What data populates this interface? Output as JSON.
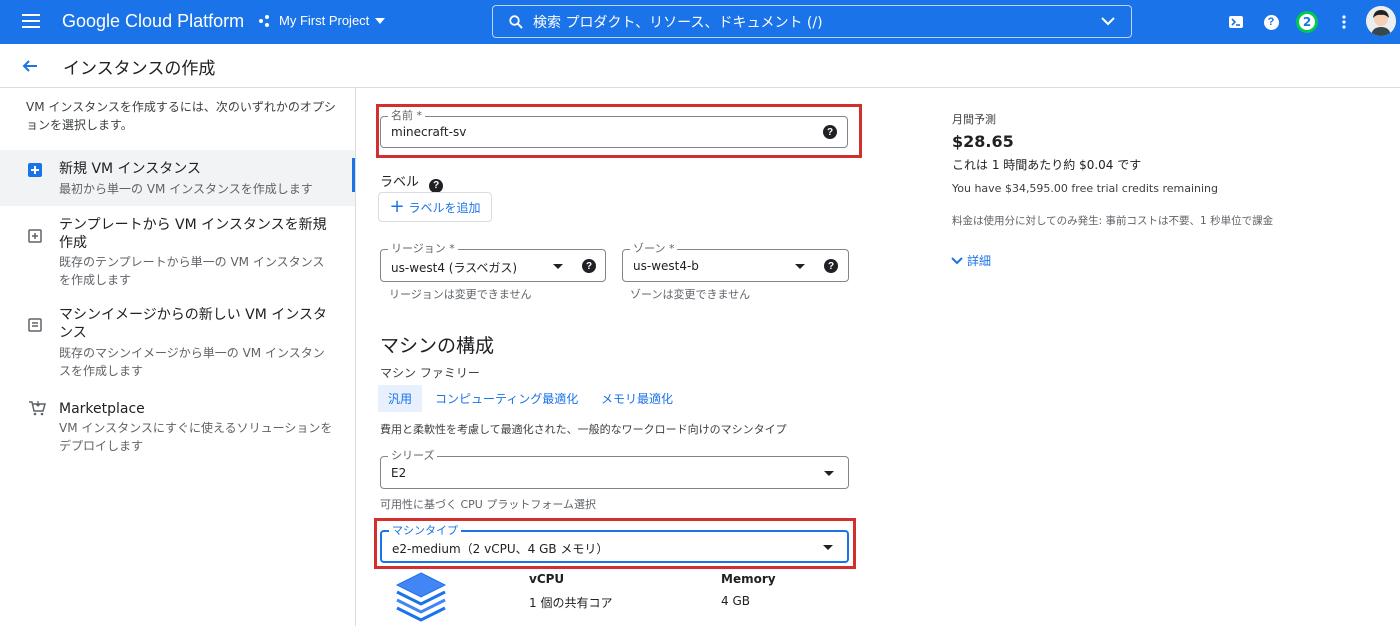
{
  "header": {
    "brand": "Google Cloud Platform",
    "project": "My First Project",
    "search_text": "検索  プロダクト、リソース、ドキュメント (/)",
    "notification_count": "2",
    "accent_color": "#1a73e8"
  },
  "page": {
    "title": "インスタンスの作成"
  },
  "left_panel": {
    "intro": "VM インスタンスを作成するには、次のいずれかのオプションを選択します。",
    "options": [
      {
        "title": "新規 VM インスタンス",
        "desc": "最初から単一の VM インスタンスを作成します",
        "icon": "add-box-icon",
        "selected": true
      },
      {
        "title": "テンプレートから VM インスタンスを新規作成",
        "desc": "既存のテンプレートから単一の VM インスタンスを作成します",
        "icon": "template-icon",
        "selected": false
      },
      {
        "title": "マシンイメージからの新しい VM インスタンス",
        "desc": "既存のマシンイメージから単一の VM インスタンスを作成します",
        "icon": "machine-image-icon",
        "selected": false
      },
      {
        "title": "Marketplace",
        "desc": "VM インスタンスにすぐに使えるソリューションをデプロイします",
        "icon": "cart-icon",
        "selected": false
      }
    ]
  },
  "form": {
    "name_label": "名前 *",
    "name_value": "minecraft-sv",
    "labels_title": "ラベル",
    "add_label": "ラベルを追加",
    "region_label": "リージョン *",
    "region_value": "us-west4 (ラスベガス)",
    "region_hint": "リージョンは変更できません",
    "zone_label": "ゾーン *",
    "zone_value": "us-west4-b",
    "zone_hint": "ゾーンは変更できません",
    "machine_section_title": "マシンの構成",
    "machine_family_label": "マシン ファミリー",
    "family_tabs": [
      "汎用",
      "コンピューティング最適化",
      "メモリ最適化"
    ],
    "family_desc": "費用と柔軟性を考慮して最適化された、一般的なワークロード向けのマシンタイプ",
    "series_label": "シリーズ",
    "series_value": "E2",
    "series_hint": "可用性に基づく CPU プラットフォーム選択",
    "machine_type_label": "マシンタイプ",
    "machine_type_value": "e2-medium（2 vCPU、4 GB メモリ）",
    "spec_vcpu_header": "vCPU",
    "spec_vcpu_value": "1 個の共有コア",
    "spec_memory_header": "Memory",
    "spec_memory_value": "4 GB"
  },
  "estimate": {
    "heading": "月間予測",
    "price": "$28.65",
    "hourly": "これは 1 時間あたり約 $0.04 です",
    "credits": "You have $34,595.00 free trial credits remaining",
    "note": "料金は使用分に対してのみ発生: 事前コストは不要、1 秒単位で課金",
    "details": "詳細"
  },
  "highlight_color": "#d32f2f"
}
